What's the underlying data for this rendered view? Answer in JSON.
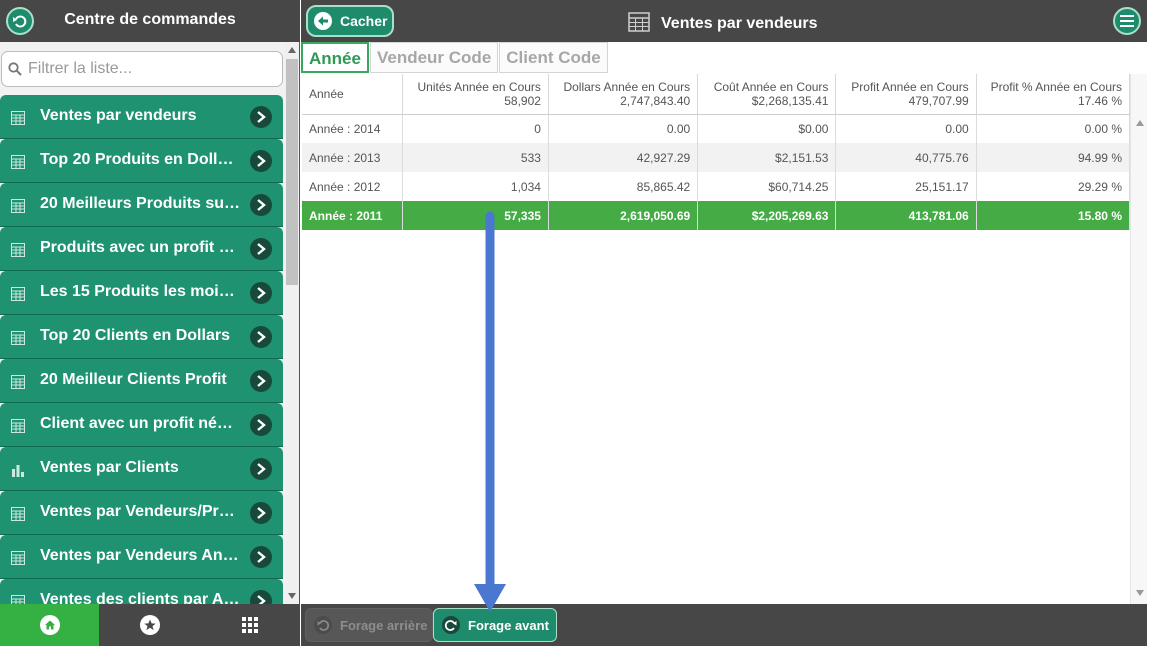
{
  "left_panel": {
    "title": "Centre de commandes",
    "filter_placeholder": "Filtrer la liste...",
    "items": [
      {
        "label": "Ventes par vendeurs",
        "icon": "table-icon"
      },
      {
        "label": "Top 20 Produits en Doll…",
        "icon": "table-icon"
      },
      {
        "label": "20 Meilleurs Produits su…",
        "icon": "table-icon"
      },
      {
        "label": "Produits avec un profit …",
        "icon": "table-icon"
      },
      {
        "label": "Les 15 Produits les moi…",
        "icon": "table-icon"
      },
      {
        "label": "Top 20 Clients en Dollars",
        "icon": "table-icon"
      },
      {
        "label": "20 Meilleur Clients Profit",
        "icon": "table-icon"
      },
      {
        "label": "Client avec un profit né…",
        "icon": "table-icon"
      },
      {
        "label": "Ventes par Clients",
        "icon": "bar-chart-icon"
      },
      {
        "label": "Ventes par Vendeurs/Pr…",
        "icon": "table-icon"
      },
      {
        "label": "Ventes par Vendeurs An…",
        "icon": "table-icon"
      },
      {
        "label": "Ventes des clients par A…",
        "icon": "table-icon"
      }
    ],
    "footer": [
      "home-icon",
      "star-icon",
      "apps-grid-icon"
    ]
  },
  "header": {
    "hide_label": "Cacher",
    "title": "Ventes par vendeurs"
  },
  "tabs": [
    {
      "label": "Année",
      "active": true
    },
    {
      "label": "Vendeur Code",
      "active": false
    },
    {
      "label": "Client Code",
      "active": false
    }
  ],
  "table": {
    "columns": [
      {
        "name": "Année",
        "total": ""
      },
      {
        "name": "Unités Année en Cours",
        "total": "58,902"
      },
      {
        "name": "Dollars Année en Cours",
        "total": "2,747,843.40"
      },
      {
        "name": "Coût Année en Cours",
        "total": "$2,268,135.41"
      },
      {
        "name": "Profit Année en Cours",
        "total": "479,707.99"
      },
      {
        "name": "Profit % Année en Cours",
        "total": "17.46 %"
      }
    ],
    "rows": [
      [
        "Année : 2014",
        "0",
        "0.00",
        "$0.00",
        "0.00",
        "0.00 %"
      ],
      [
        "Année : 2013",
        "533",
        "42,927.29",
        "$2,151.53",
        "40,775.76",
        "94.99 %"
      ],
      [
        "Année : 2012",
        "1,034",
        "85,865.42",
        "$60,714.25",
        "25,151.17",
        "29.29 %"
      ],
      [
        "Année : 2011",
        "57,335",
        "2,619,050.69",
        "$2,205,269.63",
        "413,781.06",
        "15.80 %"
      ]
    ],
    "selected_row": 3
  },
  "footer": {
    "drill_back": "Forage arrière",
    "drill_forward": "Forage avant"
  },
  "colors": {
    "accent_green": "#1e9271",
    "selected_row": "#45ab45",
    "dark_bar": "#474747",
    "annotation_arrow": "#4a78d0"
  }
}
